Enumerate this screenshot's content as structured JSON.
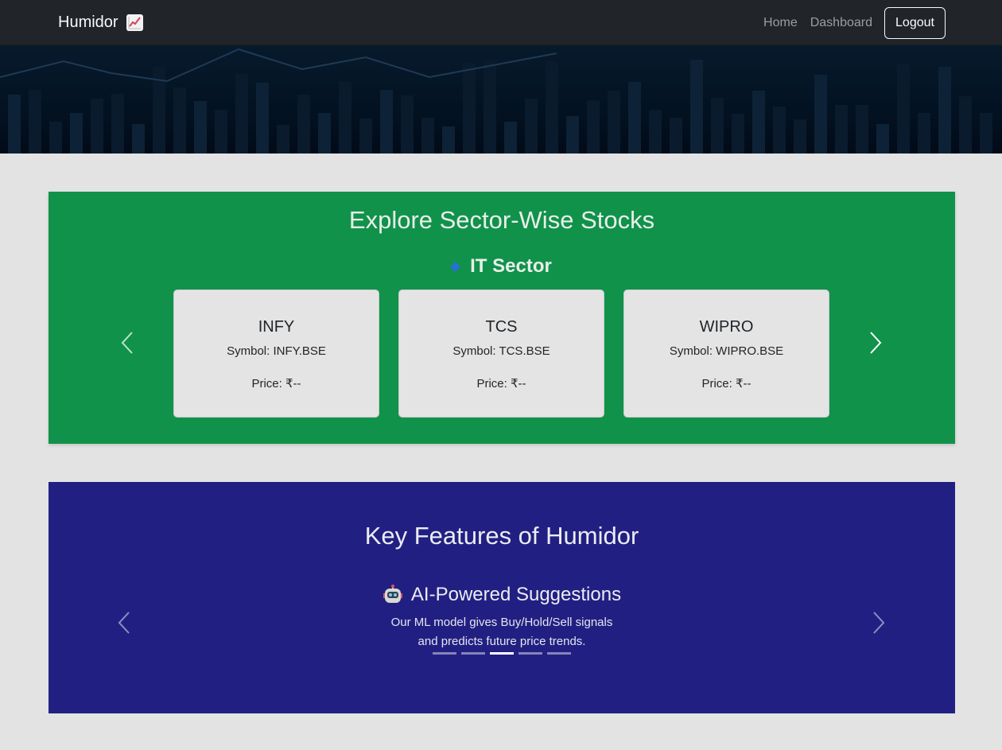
{
  "navbar": {
    "brand": "Humidor",
    "brand_icon": "chart-increasing-icon",
    "links": [
      {
        "label": "Home"
      },
      {
        "label": "Dashboard"
      }
    ],
    "logout_label": "Logout"
  },
  "sectors": {
    "title": "Explore Sector-Wise Stocks",
    "current_sector": "IT Sector",
    "sector_icon": "blue-diamond-icon",
    "stocks": [
      {
        "name": "INFY",
        "symbol": "Symbol: INFY.BSE",
        "price": "Price: ₹--"
      },
      {
        "name": "TCS",
        "symbol": "Symbol: TCS.BSE",
        "price": "Price: ₹--"
      },
      {
        "name": "WIPRO",
        "symbol": "Symbol: WIPRO.BSE",
        "price": "Price: ₹--"
      }
    ]
  },
  "features": {
    "title": "Key Features of Humidor",
    "current": {
      "icon": "robot-icon",
      "heading": "AI-Powered Suggestions",
      "desc_line1": "Our ML model gives Buy/Hold/Sell signals",
      "desc_line2": "and predicts future price trends."
    },
    "slide_count": 5,
    "active_slide": 3
  },
  "colors": {
    "navbar": "#212529",
    "sector_bg": "#10924b",
    "features_bg": "#212082",
    "page_bg": "#e3e3e3"
  }
}
